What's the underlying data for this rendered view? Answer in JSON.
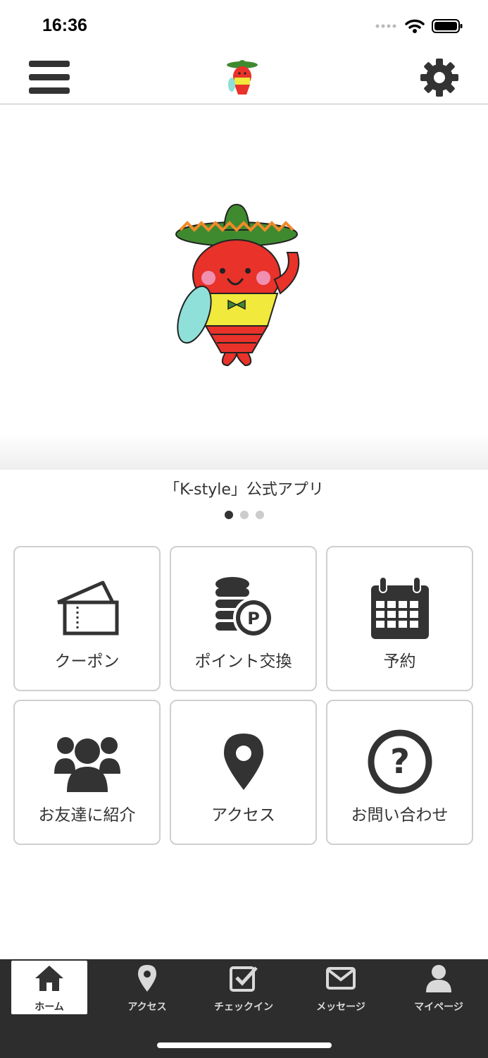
{
  "status_bar": {
    "time": "16:36"
  },
  "header": {
    "menu_icon": "hamburger-icon",
    "logo": "mascot-logo",
    "settings_icon": "gear-icon"
  },
  "hero": {
    "caption": "「K-style」公式アプリ",
    "slide_count": 3,
    "active_slide": 1
  },
  "menu_tiles": [
    {
      "label": "クーポン",
      "icon": "ticket-icon"
    },
    {
      "label": "ポイント交換",
      "icon": "coins-icon"
    },
    {
      "label": "予約",
      "icon": "calendar-icon"
    },
    {
      "label": "お友達に紹介",
      "icon": "users-icon"
    },
    {
      "label": "アクセス",
      "icon": "map-pin-icon"
    },
    {
      "label": "お問い合わせ",
      "icon": "question-circle-icon"
    }
  ],
  "tabbar": {
    "items": [
      {
        "label": "ホーム",
        "icon": "home-icon",
        "active": true
      },
      {
        "label": "アクセス",
        "icon": "map-pin-icon",
        "active": false
      },
      {
        "label": "チェックイン",
        "icon": "checkbox-icon",
        "active": false
      },
      {
        "label": "メッセージ",
        "icon": "envelope-icon",
        "active": false
      },
      {
        "label": "マイページ",
        "icon": "person-icon",
        "active": false
      }
    ]
  },
  "colors": {
    "tabbar_bg": "#2d2d2d",
    "icon_dark": "#333333",
    "tile_border": "#cfcfcf"
  }
}
